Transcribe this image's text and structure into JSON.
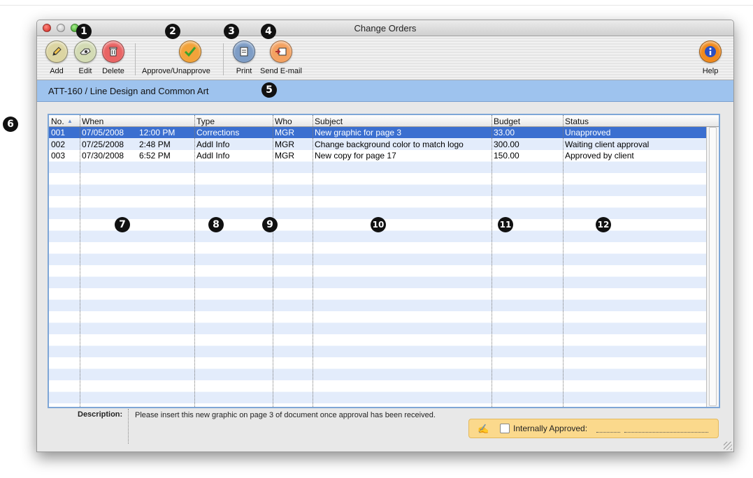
{
  "window": {
    "title": "Change Orders"
  },
  "toolbar": {
    "add": {
      "label": "Add",
      "icon": "pencil-icon",
      "color": "#d9d2a0"
    },
    "edit": {
      "label": "Edit",
      "icon": "edit-icon",
      "color": "#cfd8b0"
    },
    "delete": {
      "label": "Delete",
      "icon": "trash-icon",
      "color": "#e85b5b"
    },
    "approve": {
      "label": "Approve/Unapprove",
      "icon": "checkmark-icon",
      "color": "#f2a33a"
    },
    "print": {
      "label": "Print",
      "icon": "print-icon",
      "color": "#7a9bc4"
    },
    "email": {
      "label": "Send E-mail",
      "icon": "email-icon",
      "color": "#f4a261"
    },
    "help": {
      "label": "Help",
      "icon": "info-icon",
      "color": "#f08a1c"
    }
  },
  "project": {
    "title": "ATT-160 / Line Design and Common Art"
  },
  "table": {
    "columns": [
      "No.",
      "When",
      "Type",
      "Who",
      "Subject",
      "Budget",
      "Status"
    ],
    "rows": [
      {
        "no": "001",
        "date": "07/05/2008",
        "time": "12:00 PM",
        "type": "Corrections",
        "who": "MGR",
        "subject": "New graphic for page 3",
        "budget": "33.00",
        "status": "Unapproved",
        "selected": true
      },
      {
        "no": "002",
        "date": "07/25/2008",
        "time": "2:48 PM",
        "type": "Addl Info",
        "who": "MGR",
        "subject": "Change background color to match logo",
        "budget": "300.00",
        "status": "Waiting client approval",
        "selected": false
      },
      {
        "no": "003",
        "date": "07/30/2008",
        "time": "6:52 PM",
        "type": "Addl Info",
        "who": "MGR",
        "subject": "New copy for page 17",
        "budget": "150.00",
        "status": "Approved by client",
        "selected": false
      }
    ]
  },
  "description": {
    "label": "Description:",
    "text": "Please insert this new graphic on page 3 of document once approval has been received."
  },
  "internal_approval": {
    "label": "Internally Approved:",
    "checked": false
  },
  "callouts": [
    "1",
    "2",
    "3",
    "4",
    "5",
    "6",
    "7",
    "8",
    "9",
    "10",
    "11",
    "12"
  ],
  "colors": {
    "selection": "#3b6fd0",
    "project_bar": "#9ec3ee",
    "stripe": "#e3ecfb",
    "approval_box": "#fbd98c"
  }
}
